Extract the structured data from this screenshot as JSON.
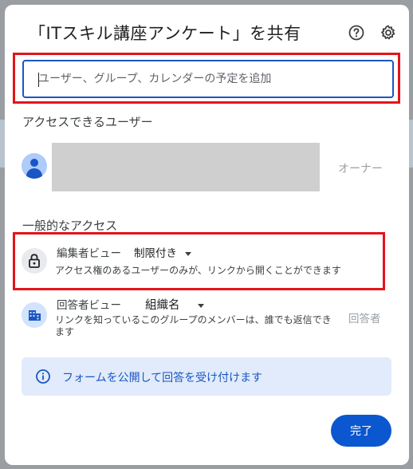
{
  "dialog": {
    "title": "「ITスキル講座アンケート」を共有",
    "help_icon": "help-circle-icon",
    "settings_icon": "gear-icon"
  },
  "add_people": {
    "placeholder": "ユーザー、グループ、カレンダーの予定を追加"
  },
  "users_section": {
    "label": "アクセスできるユーザー",
    "owner": {
      "role": "オーナー",
      "avatar_icon": "person-icon"
    }
  },
  "general_access": {
    "label": "一般的なアクセス",
    "editor_view": {
      "label": "編集者ビュー",
      "selected": "制限付き",
      "description": "アクセス権のあるユーザーのみが、リンクから開くことができます",
      "icon": "lock-icon"
    },
    "responder_view": {
      "label": "回答者ビュー",
      "selected": "組織名",
      "description_line1": "リンクを知っているこのグループのメンバーは、誰でも返信でき",
      "description_line2": "ます",
      "role": "回答者",
      "icon": "organization-icon"
    }
  },
  "publish_banner": {
    "text": "フォームを公開して回答を受け付けます",
    "icon": "info-icon"
  },
  "actions": {
    "done": "完了"
  },
  "colors": {
    "accent": "#0b57d0",
    "highlight": "#e3141c",
    "banner_bg": "#e1ebfb"
  }
}
